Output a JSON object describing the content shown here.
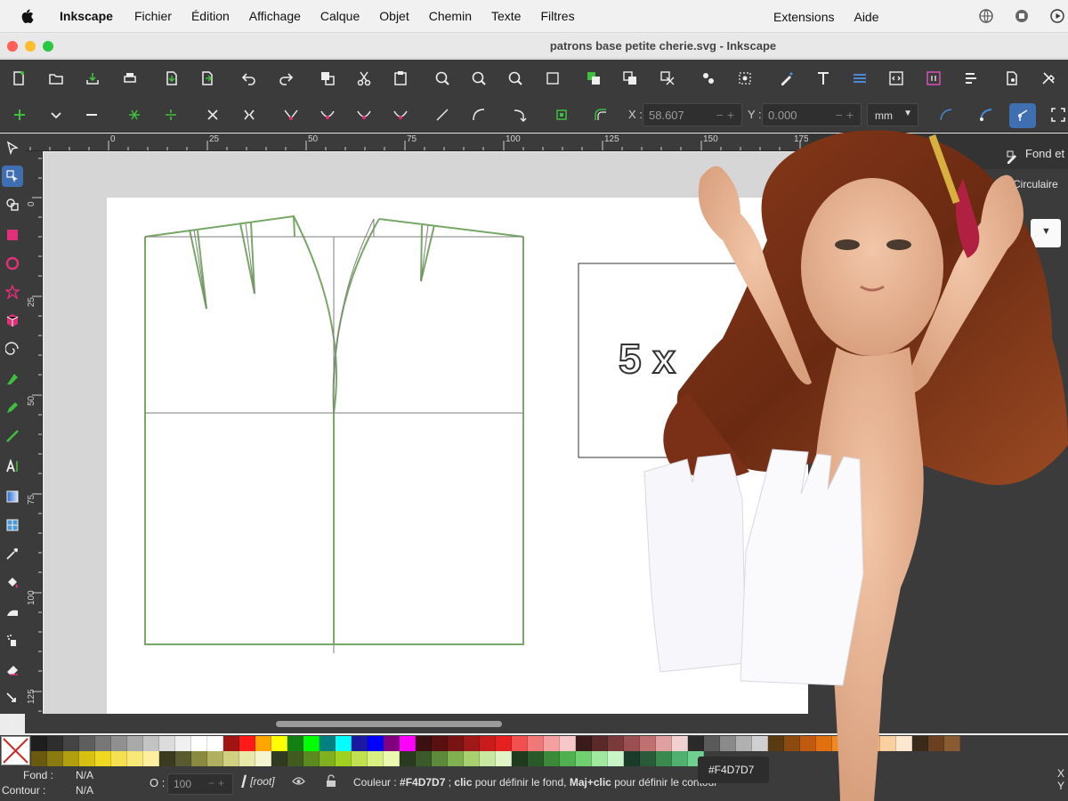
{
  "menubar": {
    "app_name": "Inkscape",
    "items": [
      "Fichier",
      "Édition",
      "Affichage",
      "Calque",
      "Objet",
      "Chemin",
      "Texte",
      "Filtres"
    ],
    "right_items": [
      "Extensions",
      "Aide"
    ]
  },
  "window": {
    "title": "patrons base petite cherie.svg - Inkscape"
  },
  "controls": {
    "x_label": "X :",
    "x_value": "58.607",
    "y_label": "Y :",
    "y_value": "0.000",
    "unit": "mm"
  },
  "ruler": {
    "top_labels": [
      "0",
      "25",
      "50",
      "75",
      "100",
      "125",
      "150",
      "175"
    ],
    "left_labels": [
      "0",
      "25",
      "50",
      "75",
      "100",
      "125"
    ]
  },
  "canvas": {
    "label_text": "5 x"
  },
  "dock": {
    "fill_tab": "Fond et c",
    "circular_label": "Circulaire"
  },
  "palette": {
    "row1": [
      "#1e1e1e",
      "#2e2e2e",
      "#444444",
      "#5e5e5e",
      "#777777",
      "#909090",
      "#a9a9a9",
      "#c3c3c3",
      "#dcdcdc",
      "#f0f0f0",
      "#ffffff",
      "#ffffff",
      "#a01414",
      "#ff1a1a",
      "#ffa500",
      "#ffff00",
      "#138013",
      "#00ff00",
      "#008080",
      "#00ffff",
      "#1a1aa0",
      "#0000ff",
      "#800080",
      "#ff00ff",
      "#3a1010",
      "#5a1010",
      "#7a1414",
      "#a01818",
      "#c81c1c",
      "#e62020",
      "#f05050",
      "#f07878",
      "#f5a0a0",
      "#f8c8c8",
      "#3a1a1a",
      "#5a2a2a",
      "#7a3a3a",
      "#9a5050",
      "#c07070",
      "#e0a0a0",
      "#f0d0d0",
      "#2a2a2a",
      "#5a5a5a",
      "#8a8a8a",
      "#b0b0b0",
      "#d0d0d0",
      "#5a3a10",
      "#8a4a10",
      "#c05a10",
      "#e07010",
      "#f08a20",
      "#f5a050",
      "#f8b878",
      "#fad0a0",
      "#fce8d0",
      "#3a2a1a",
      "#6a4020",
      "#8a5a30"
    ],
    "row2": [
      "#6a5a10",
      "#8a7a10",
      "#b0a010",
      "#d8c010",
      "#f0d820",
      "#f5e050",
      "#f8e878",
      "#fcf0a0",
      "#3a3a20",
      "#5a5a30",
      "#8a8a40",
      "#b0b060",
      "#d0d080",
      "#e8e8a8",
      "#f4f4d0",
      "#303a20",
      "#405a20",
      "#5a8a20",
      "#80b020",
      "#a0d020",
      "#c0e050",
      "#d8f080",
      "#eaf8b0",
      "#2a3a20",
      "#3a5a2a",
      "#5a8a3a",
      "#80b050",
      "#a8d070",
      "#c8e8a0",
      "#e0f4c8",
      "#203a20",
      "#2a5a2a",
      "#3a8a3a",
      "#50b050",
      "#70d070",
      "#a0e8a0",
      "#c8f4c8",
      "#1a3a2a",
      "#2a5a3a",
      "#3a8a50",
      "#50b070",
      "#70d090"
    ],
    "fill_label": "Fond :",
    "fill_value": "N/A",
    "stroke_label": "Contour :",
    "stroke_value": "N/A"
  },
  "status": {
    "opacity_label": "O :",
    "opacity_value": "100",
    "layer": "[root]",
    "message_prefix": "Couleur : ",
    "message_color": "#F4D7D7",
    "message_sep": " ; ",
    "message_click": "clic",
    "message_fill": " pour définir le fond, ",
    "message_shift": "Maj+clic",
    "message_stroke": " pour définir le contour",
    "xy_x": "X",
    "xy_y": "Y"
  },
  "tooltip": {
    "color": "#F4D7D7"
  }
}
